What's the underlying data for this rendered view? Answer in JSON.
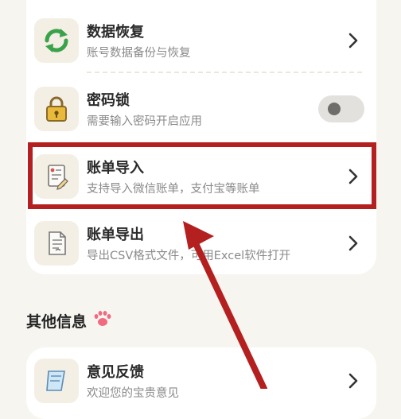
{
  "settings": {
    "items": [
      {
        "title": "数据恢复",
        "subtitle": "账号数据备份与恢复",
        "icon": "sync-icon",
        "control": "chevron"
      },
      {
        "title": "密码锁",
        "subtitle": "需要输入密码开启应用",
        "icon": "padlock-icon",
        "control": "toggle",
        "toggle_on": false
      },
      {
        "title": "账单导入",
        "subtitle": "支持导入微信账单，支付宝等账单",
        "icon": "bill-import-icon",
        "control": "chevron"
      },
      {
        "title": "账单导出",
        "subtitle": "导出CSV格式文件，可用Excel软件打开",
        "icon": "bill-export-icon",
        "control": "chevron"
      }
    ]
  },
  "other_section": {
    "title": "其他信息",
    "icon": "paw-icon",
    "items": [
      {
        "title": "意见反馈",
        "subtitle": "欢迎您的宝贵意见",
        "icon": "feedback-icon",
        "control": "chevron"
      }
    ]
  },
  "annotation": {
    "color": "#b3201f",
    "highlighted_item": "账单导入"
  }
}
